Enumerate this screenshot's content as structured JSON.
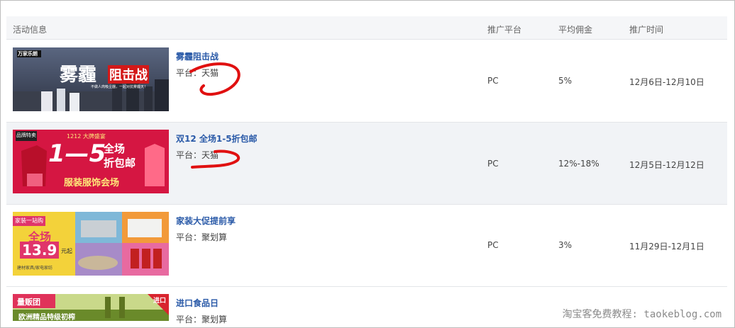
{
  "header": {
    "col_activity": "活动信息",
    "col_platform": "推广平台",
    "col_commission": "平均佣金",
    "col_time": "推广时间"
  },
  "rows": [
    {
      "title": "雾霾阻击战",
      "platform": "平台：天猫",
      "promo_platform": "PC",
      "commission": "5%",
      "time": "12月6日-12月10日",
      "banner": {
        "main": "雾霾",
        "accent": "阻击战",
        "tag": "万家乐朗",
        "sub": "不做人肉吸尘器，一起对抗雾霾天！"
      }
    },
    {
      "title": "双12 全场1-5折包邮",
      "platform": "平台：天猫",
      "promo_platform": "PC",
      "commission": "12%-18%",
      "time": "12月5日-12月12日",
      "banner": {
        "tag": "1212 大牌盛宴",
        "big": "1—5",
        "side1": "全场",
        "side2": "折包邮",
        "sub": "服装服饰会场",
        "logo": "品牌特卖"
      }
    },
    {
      "title": "家装大促提前享",
      "platform": "平台：聚划算",
      "promo_platform": "PC",
      "commission": "3%",
      "time": "11月29日-12月1日",
      "banner": {
        "tag": "家装一站购",
        "big1": "全场",
        "big2": "13.9",
        "unit": "元起",
        "sub": "建材家具/家电家纺"
      }
    },
    {
      "title": "进口食品日",
      "platform": "平台：聚划算",
      "promo_platform": "",
      "commission": "",
      "time": "",
      "banner": {
        "tag": "量贩团",
        "corner": "进口",
        "sub": "欧洲精品特级初榨"
      }
    }
  ],
  "watermark": "淘宝客免费教程: taokeblog.com",
  "colors": {
    "link": "#2a5aa8",
    "annotation": "#e01010",
    "alt_row": "#f1f3f6"
  }
}
